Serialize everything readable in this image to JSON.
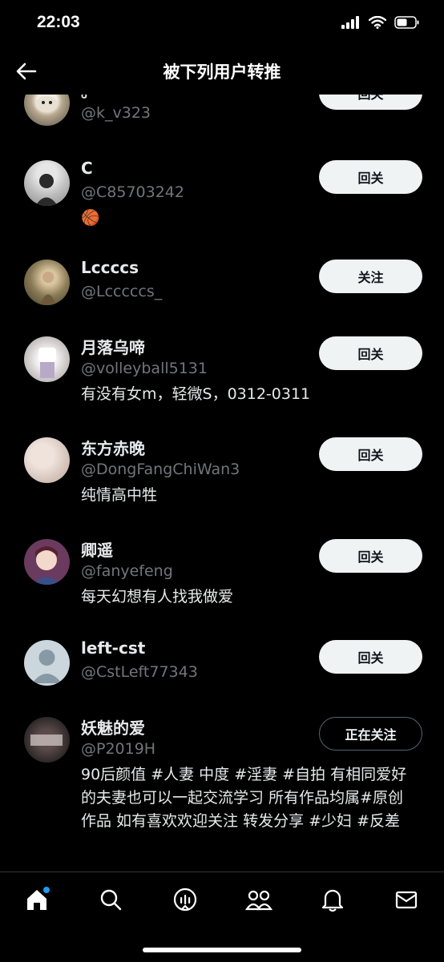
{
  "status_bar": {
    "time": "22:03"
  },
  "header": {
    "title": "被下列用户转推"
  },
  "users": [
    {
      "name": "。",
      "handle": "@k_v323",
      "bio": "",
      "button": "回关",
      "button_style": "filled"
    },
    {
      "name": "C",
      "handle": "@C85703242",
      "bio": "🏀",
      "button": "回关",
      "button_style": "filled"
    },
    {
      "name": "Lccccs",
      "handle": "@Lcccccs_",
      "bio": "",
      "button": "关注",
      "button_style": "filled"
    },
    {
      "name": "月落乌啼",
      "handle": "@volleyball5131",
      "bio": "有没有女m，轻微S，0312-0311",
      "button": "回关",
      "button_style": "filled"
    },
    {
      "name": "东方赤晚",
      "handle": "@DongFangChiWan3",
      "bio": "纯情高中牲",
      "button": "回关",
      "button_style": "filled"
    },
    {
      "name": "卿遥",
      "handle": "@fanyefeng",
      "bio": "每天幻想有人找我做爱",
      "button": "回关",
      "button_style": "filled"
    },
    {
      "name": "left-cst",
      "handle": "@CstLeft77343",
      "bio": "",
      "button": "回关",
      "button_style": "filled"
    },
    {
      "name": "妖魅的爱",
      "handle": "@P2019H",
      "bio": "90后颜值 #人妻 中度 #淫妻 #自拍 有相同爱好的夫妻也可以一起交流学习 所有作品均属#原创 作品 如有喜欢欢迎关注 转发分享 #少妇 #反差",
      "button": "正在关注",
      "button_style": "outline"
    }
  ],
  "tabs": [
    "home-icon",
    "search-icon",
    "spaces-icon",
    "communities-icon",
    "notifications-icon",
    "messages-icon"
  ],
  "colors": {
    "background": "#000000",
    "text": "#e7e9ea",
    "secondary": "#71767b",
    "button": "#eff3f4",
    "accent": "#1d9bf0"
  }
}
